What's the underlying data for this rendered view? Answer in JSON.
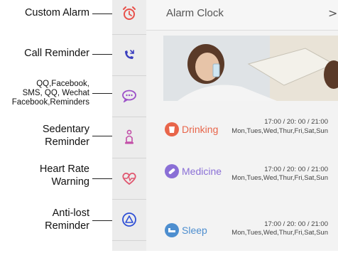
{
  "callouts": {
    "custom_alarm": "Custom Alarm",
    "call_reminder": "Call Reminder",
    "social_line1": "QQ,Facebook,",
    "social_line2": "SMS, QQ, Wechat",
    "social_line3": "Facebook,Reminders",
    "sedentary_line1": "Sedentary",
    "sedentary_line2": "Reminder",
    "heart_line1": "Heart Rate",
    "heart_line2": "Warning",
    "antilost_line1": "Anti-lost",
    "antilost_line2": "Reminder"
  },
  "icons": {
    "alarm": "alarm-clock-icon",
    "call": "missed-call-icon",
    "message": "message-bubble-icon",
    "sedentary": "sitting-person-icon",
    "heart": "heart-rate-icon",
    "antilost": "warning-triangle-icon"
  },
  "colors": {
    "alarm": "#e8504a",
    "call": "#3b3fbf",
    "message": "#9b4fc8",
    "sedentary": "#c34fa8",
    "heart": "#e0566f",
    "antilost": "#2e4fd6",
    "drinking": "#e8654a",
    "medicine": "#8a6fd6",
    "sleep": "#4d8ecf"
  },
  "app": {
    "title": "Alarm Clock",
    "chevron": ">"
  },
  "reminders": [
    {
      "name": "Drinking",
      "times": "17:00 / 20:  00 / 21:00",
      "days": "Mon,Tues,Wed,Thur,Fri,Sat,Sun",
      "icon": "cup-icon"
    },
    {
      "name": "Medicine",
      "times": "17:00 / 20:  00 / 21:00",
      "days": "Mon,Tues,Wed,Thur,Fri,Sat,Sun",
      "icon": "pill-icon"
    },
    {
      "name": "Sleep",
      "times": "17:00 / 20:  00 / 21:00",
      "days": "Mon,Tues,Wed,Thur,Fri,Sat,Sun",
      "icon": "bed-icon"
    }
  ]
}
